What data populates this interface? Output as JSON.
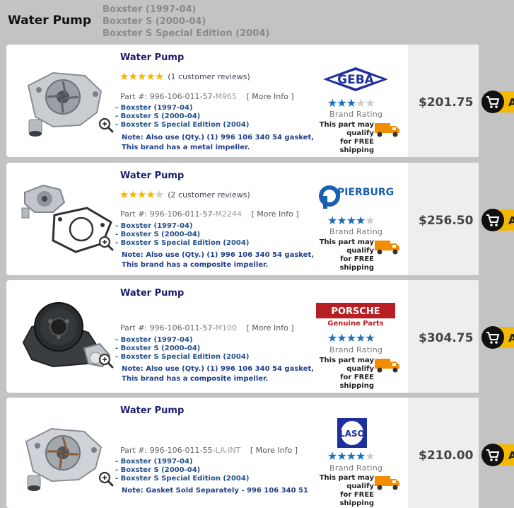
{
  "header": {
    "title": "Water Pump",
    "models": [
      "Boxster (1997-04)",
      "Boxster S (2000-04)",
      "Boxster S Special Edition (2004)"
    ]
  },
  "products": [
    {
      "title": "Water Pump",
      "review_stars": 5,
      "reviews": "(1 customer reviews)",
      "part_prefix": "Part #: 996-106-011-57-",
      "part_suffix": "M965",
      "more_info": "[ More Info ]",
      "fits": [
        "- Boxster (1997-04)",
        "- Boxster S (2000-04)",
        "- Boxster S Special Edition (2004)"
      ],
      "note": [
        "Note: Also use (Qty.) (1) 996 106 340 54 gasket,",
        "This brand has a metal impeller."
      ],
      "brand": "GEBA",
      "brand_stars": 3,
      "brand_rating_label": "Brand Rating",
      "free_ship": [
        "This part may qualify",
        "for FREE shipping"
      ],
      "price": "$201.75"
    },
    {
      "title": "Water Pump",
      "review_stars": 4,
      "reviews": "(2 customer reviews)",
      "part_prefix": "Part #: 996-106-011-57-",
      "part_suffix": "M2244",
      "more_info": "[ More Info ]",
      "fits": [
        "- Boxster (1997-04)",
        "- Boxster S (2000-04)",
        "- Boxster S Special Edition (2004)"
      ],
      "note": [
        "Note: Also use (Qty.) (1) 996 106 340 54 gasket,",
        "This brand has a composite impeller."
      ],
      "brand": "PIERBURG",
      "brand_stars": 4,
      "brand_rating_label": "Brand Rating",
      "free_ship": [
        "This part may qualify",
        "for FREE shipping"
      ],
      "price": "$256.50"
    },
    {
      "title": "Water Pump",
      "part_prefix": "Part #: 996-106-011-57-",
      "part_suffix": "M100",
      "more_info": "[ More Info ]",
      "fits": [
        "- Boxster (1997-04)",
        "- Boxster S (2000-04)",
        "- Boxster S Special Edition (2004)"
      ],
      "note": [
        "Note: Also use (Qty.) (1) 996 106 340 54 gasket,",
        "This brand has a composite impeller."
      ],
      "brand": "PORSCHE",
      "brand_sub": "Genuine Parts",
      "brand_stars": 5,
      "brand_rating_label": "Brand Rating",
      "free_ship": [
        "This part may qualify",
        "for FREE shipping"
      ],
      "price": "$304.75"
    },
    {
      "title": "Water Pump",
      "part_prefix": "Part #: 996-106-011-55-",
      "part_suffix": "LA-INT",
      "more_info": "[ More Info ]",
      "fits": [
        "- Boxster (1997-04)",
        "- Boxster S (2000-04)",
        "- Boxster S Special Edition (2004)"
      ],
      "note": [
        "Note: Gasket Sold Separately - 996 106 340 51"
      ],
      "brand": "LASO",
      "brand_stars": 4,
      "brand_rating_label": "Brand Rating",
      "free_ship": [
        "This part may qualify",
        "for FREE shipping"
      ],
      "price": "$210.00"
    }
  ],
  "colors": {
    "star_gold": "#f5b400",
    "star_blue": "#1a6fb8",
    "star_empty": "#cccccc",
    "title_navy": "#1d1d6e",
    "truck_orange": "#f28c00"
  }
}
